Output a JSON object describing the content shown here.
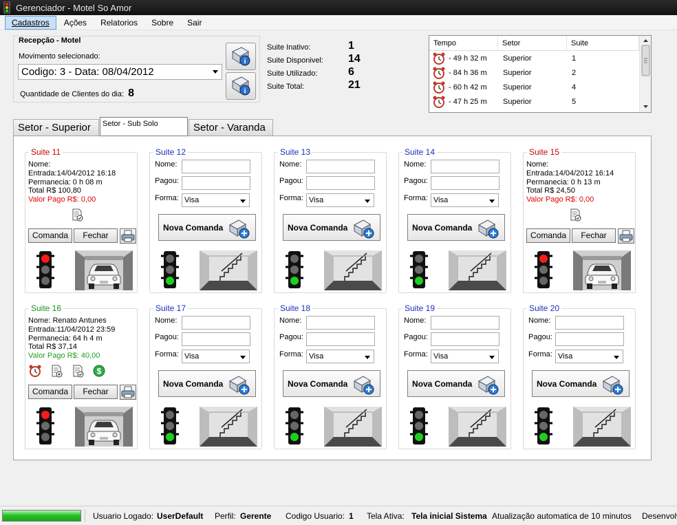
{
  "window": {
    "title": "Gerenciador - Motel So Amor"
  },
  "menu": [
    "Cadastros",
    "Ações",
    "Relatorios",
    "Sobre",
    "Sair"
  ],
  "reception": {
    "title": "Recepção - Motel",
    "movement_label": "Movimento selecionado:",
    "movement_value": "Codigo: 3 - Data: 08/04/2012",
    "clients_label": "Quantidade de Clientes do dia:",
    "clients_value": "8"
  },
  "stats": [
    {
      "label": "Suite Inativo:",
      "value": "1"
    },
    {
      "label": "Suite Disponivel:",
      "value": "14"
    },
    {
      "label": "Suite Utilizado:",
      "value": "6"
    },
    {
      "label": "Suite Total:",
      "value": "21"
    }
  ],
  "timer_table": {
    "headers": [
      "Tempo",
      "Setor",
      "Suite"
    ],
    "rows": [
      [
        "- 49 h 32 m",
        "Superior",
        "1"
      ],
      [
        "- 84 h 36 m",
        "Superior",
        "2"
      ],
      [
        "- 60 h 42 m",
        "Superior",
        "4"
      ],
      [
        "- 47 h 25 m",
        "Superior",
        "5"
      ]
    ]
  },
  "tabs": [
    "Setor - Superior",
    "Setor - Sub Solo",
    "Setor - Varanda"
  ],
  "labels": {
    "nome": "Nome:",
    "pagou": "Pagou:",
    "forma": "Forma:",
    "visa": "Visa",
    "nova": "Nova Comanda",
    "comanda": "Comanda",
    "fechar": "Fechar"
  },
  "suites": [
    {
      "title": "Suite 11",
      "color": "#cc0000",
      "occupied": true,
      "lines": [
        "Nome:",
        "Entrada:14/04/2012 16:18",
        "Permanecia: 0 h 08 m",
        "Total R$ 100,80"
      ],
      "paid": "Valor Pago R$: 0,00",
      "paid_color": "#e00000",
      "icons": [
        "receipt-check-icon"
      ]
    },
    {
      "title": "Suite 12",
      "color": "#1a2fbf",
      "occupied": false
    },
    {
      "title": "Suite 13",
      "color": "#1a2fbf",
      "occupied": false
    },
    {
      "title": "Suite 14",
      "color": "#1a2fbf",
      "occupied": false
    },
    {
      "title": "Suite 15",
      "color": "#cc0000",
      "occupied": true,
      "lines": [
        "Nome:",
        "Entrada:14/04/2012 16:14",
        "Permanecia: 0 h 13 m",
        "Total R$ 24,50"
      ],
      "paid": "Valor Pago R$: 0,00",
      "paid_color": "#e00000",
      "icons": [
        "receipt-check-icon"
      ]
    },
    {
      "title": "Suite 16",
      "color": "#1f8f1f",
      "occupied": true,
      "lines": [
        "Nome: Renato Antunes",
        "Entrada:11/04/2012 23:59",
        "Permanecia: 64 h 4 m",
        "Total R$ 37,14"
      ],
      "paid": "Valor Pago R$: 40,00",
      "paid_color": "#1f9f1f",
      "icons": [
        "alarm-clock-icon",
        "receipt-add-icon",
        "receipt-check-icon",
        "money-icon"
      ]
    },
    {
      "title": "Suite 17",
      "color": "#1a2fbf",
      "occupied": false
    },
    {
      "title": "Suite 18",
      "color": "#1a2fbf",
      "occupied": false
    },
    {
      "title": "Suite 19",
      "color": "#1a2fbf",
      "occupied": false
    },
    {
      "title": "Suite 20",
      "color": "#1a2fbf",
      "occupied": false
    }
  ],
  "status": {
    "user_label": "Usuario Logado:",
    "user": "UserDefault",
    "profile_label": "Perfil:",
    "profile": "Gerente",
    "code_label": "Codigo Usuario:",
    "code": "1",
    "screen_label": "Tela Ativa:",
    "screen": "Tela inicial Sistema",
    "auto": "Atualização automatica de 10 minutos",
    "dev": "Desenvolv"
  }
}
